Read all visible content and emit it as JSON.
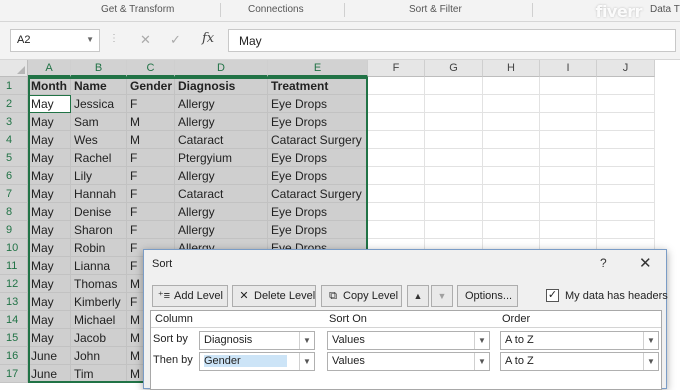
{
  "ribbon": {
    "groups": [
      "Get & Transform",
      "Connections",
      "Sort & Filter",
      "Data T"
    ],
    "watermark": "fiverr"
  },
  "formula_bar": {
    "name_box": "A2",
    "fx_label": "fx",
    "cancel_icon": "✕",
    "enter_icon": "✓",
    "value": "May"
  },
  "columns": [
    "A",
    "B",
    "C",
    "D",
    "E",
    "F",
    "G",
    "H",
    "I",
    "J"
  ],
  "header_row": {
    "month": "Month",
    "name": "Name",
    "gender": "Gender",
    "diagnosis": "Diagnosis",
    "treatment": "Treatment"
  },
  "rows": [
    {
      "num": "1"
    },
    {
      "num": "2",
      "month": "May",
      "name": "Jessica",
      "gender": "F",
      "diagnosis": "Allergy",
      "treatment": "Eye Drops"
    },
    {
      "num": "3",
      "month": "May",
      "name": "Sam",
      "gender": "M",
      "diagnosis": "Allergy",
      "treatment": "Eye Drops"
    },
    {
      "num": "4",
      "month": "May",
      "name": "Wes",
      "gender": "M",
      "diagnosis": "Cataract",
      "treatment": "Cataract Surgery"
    },
    {
      "num": "5",
      "month": "May",
      "name": "Rachel",
      "gender": "F",
      "diagnosis": "Ptergyium",
      "treatment": "Eye Drops"
    },
    {
      "num": "6",
      "month": "May",
      "name": "Lily",
      "gender": "F",
      "diagnosis": "Allergy",
      "treatment": "Eye Drops"
    },
    {
      "num": "7",
      "month": "May",
      "name": "Hannah",
      "gender": "F",
      "diagnosis": "Cataract",
      "treatment": "Cataract Surgery"
    },
    {
      "num": "8",
      "month": "May",
      "name": "Denise",
      "gender": "F",
      "diagnosis": "Allergy",
      "treatment": "Eye Drops"
    },
    {
      "num": "9",
      "month": "May",
      "name": "Sharon",
      "gender": "F",
      "diagnosis": "Allergy",
      "treatment": "Eye Drops"
    },
    {
      "num": "10",
      "month": "May",
      "name": "Robin",
      "gender": "F",
      "diagnosis": "Allergy",
      "treatment": "Eye Drops"
    },
    {
      "num": "11",
      "month": "May",
      "name": "Lianna",
      "gender": "F"
    },
    {
      "num": "12",
      "month": "May",
      "name": "Thomas",
      "gender": "M"
    },
    {
      "num": "13",
      "month": "May",
      "name": "Kimberly",
      "gender": "F"
    },
    {
      "num": "14",
      "month": "May",
      "name": "Michael",
      "gender": "M"
    },
    {
      "num": "15",
      "month": "May",
      "name": "Jacob",
      "gender": "M"
    },
    {
      "num": "16",
      "month": "June",
      "name": "John",
      "gender": "M"
    },
    {
      "num": "17",
      "month": "June",
      "name": "Tim",
      "gender": "M"
    }
  ],
  "sort_dialog": {
    "title": "Sort",
    "help": "?",
    "close": "✕",
    "add_level": "Add Level",
    "delete_level": "Delete Level",
    "copy_level": "Copy Level",
    "options": "Options...",
    "has_headers_label": "My data has headers",
    "has_headers_checked": "✓",
    "col_header_column": "Column",
    "col_header_sort_on": "Sort On",
    "col_header_order": "Order",
    "levels": [
      {
        "label": "Sort by",
        "column": "Diagnosis",
        "sort_on": "Values",
        "order": "A to Z"
      },
      {
        "label": "Then by",
        "column": "Gender",
        "sort_on": "Values",
        "order": "A to Z"
      }
    ]
  },
  "colors": {
    "accent": "#217346",
    "selection": "#cfcfcf",
    "dialog_border": "#7a9cc6"
  }
}
